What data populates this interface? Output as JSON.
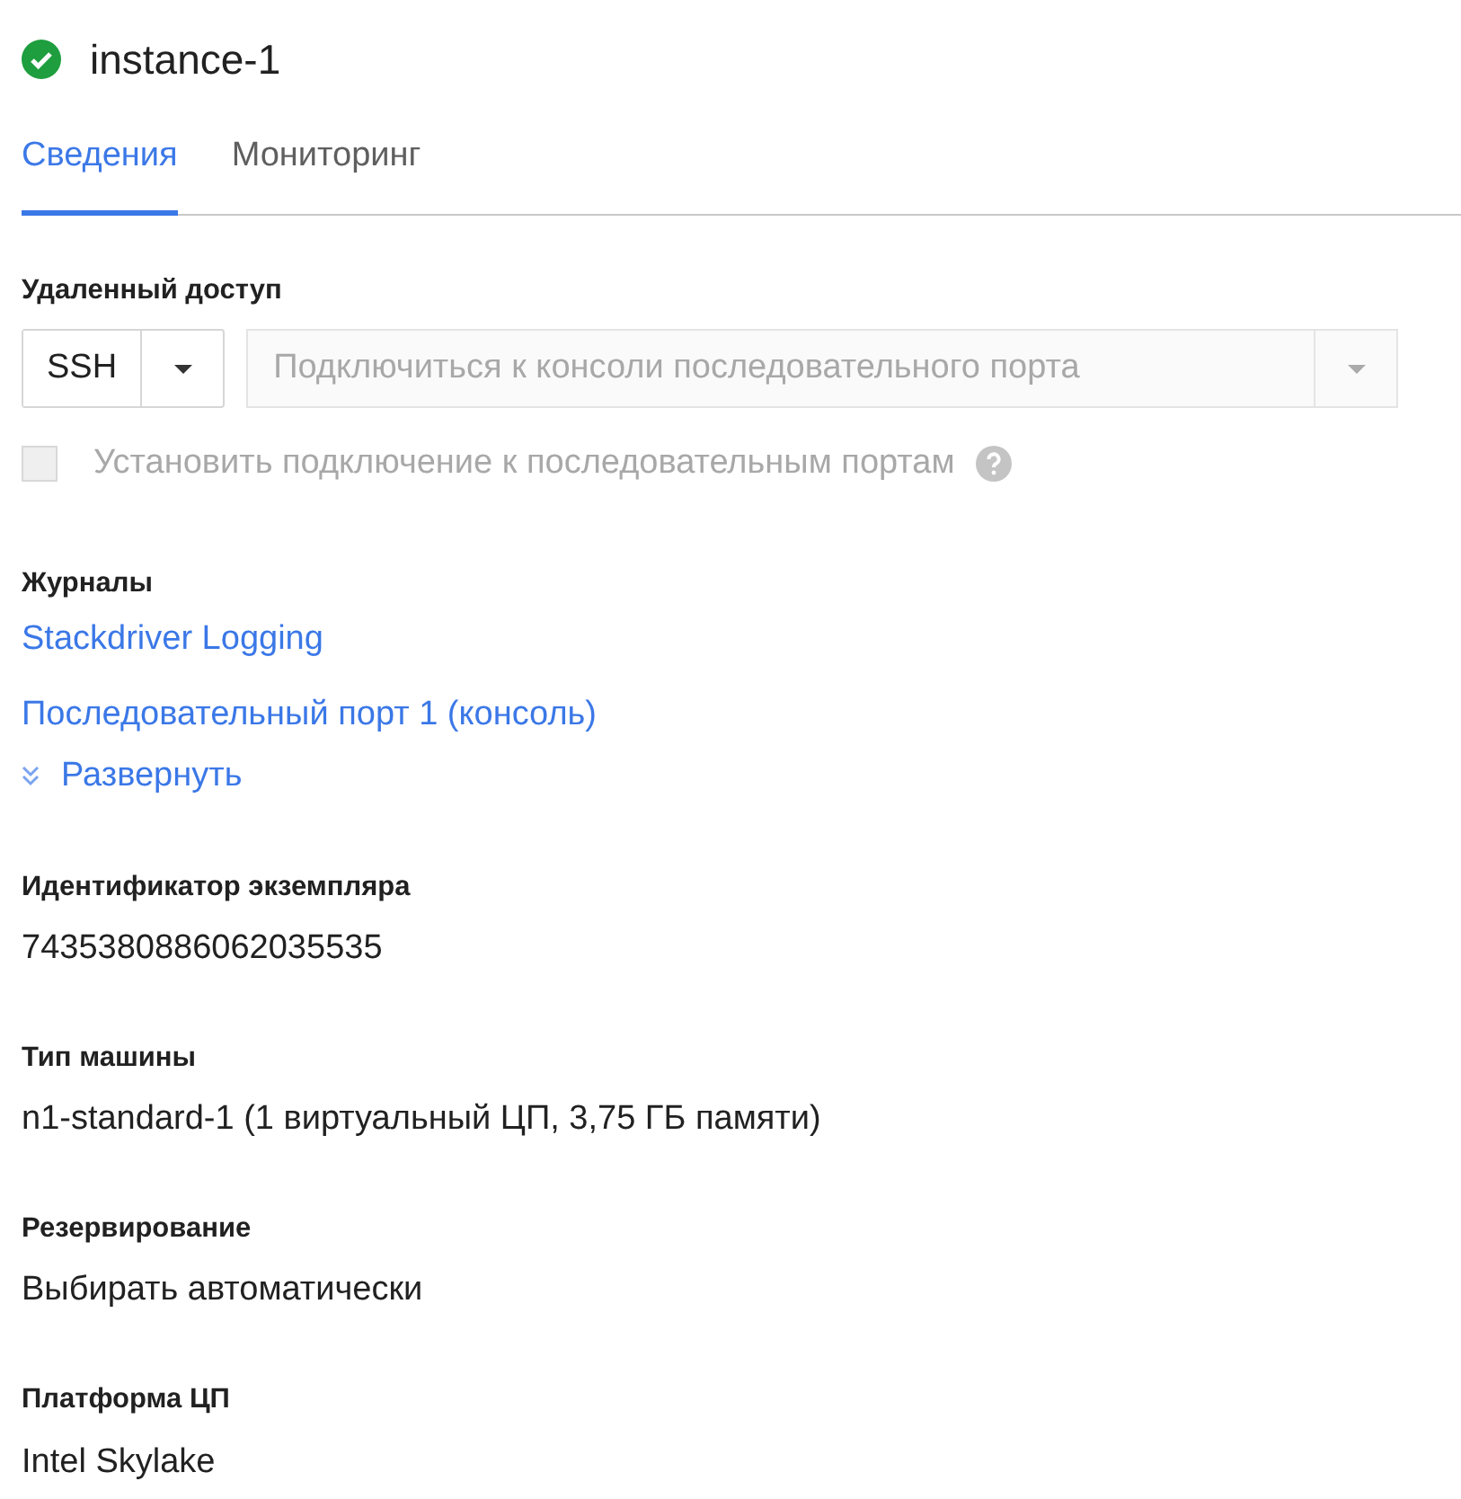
{
  "header": {
    "title": "instance-1",
    "healthy": true
  },
  "tabs": [
    {
      "label": "Сведения",
      "selected": true
    },
    {
      "label": "Мониторинг",
      "selected": false
    }
  ],
  "remote_access": {
    "heading": "Удаленный доступ",
    "ssh_button": "SSH",
    "serial_console": {
      "placeholder": "Подключиться к консоли последовательного порта",
      "disabled": true
    },
    "serial_checkbox": {
      "label": "Установить подключение к последовательным портам",
      "checked": false,
      "disabled": true
    }
  },
  "logs": {
    "heading": "Журналы",
    "links": [
      "Stackdriver Logging",
      "Последовательный порт 1 (консоль)"
    ],
    "expand_link": "Развернуть"
  },
  "fields": [
    {
      "heading": "Идентификатор экземпляра",
      "value": "7435380886062035535"
    },
    {
      "heading": "Тип машины",
      "value": "n1-standard-1 (1 виртуальный ЦП, 3,75 ГБ памяти)"
    },
    {
      "heading": "Резервирование",
      "value": "Выбирать автоматически"
    },
    {
      "heading": "Платформа ЦП",
      "value": "Intel Skylake"
    }
  ]
}
